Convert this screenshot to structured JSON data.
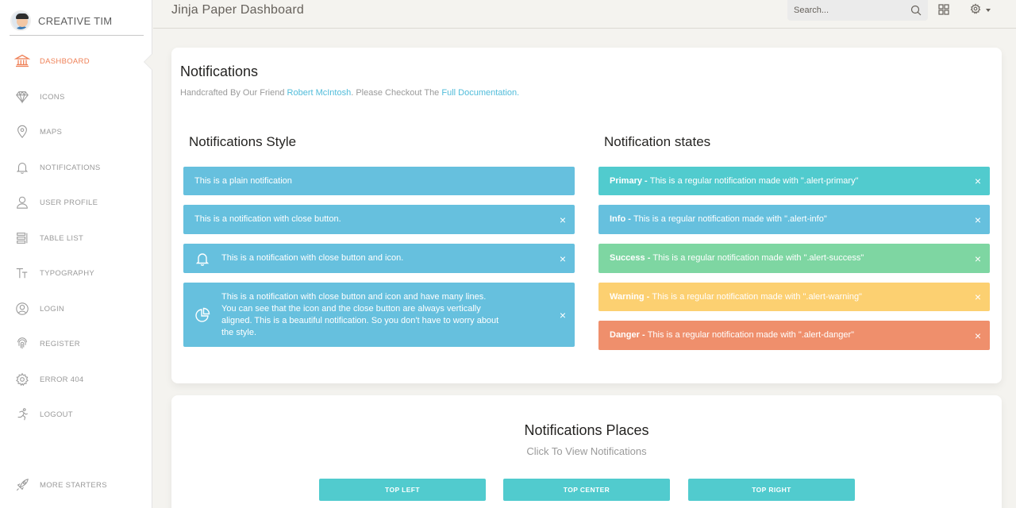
{
  "colors": {
    "primary": "#51cbce",
    "info": "#66c0de",
    "success": "#7ed6a2",
    "warning": "#fcd071",
    "danger": "#ef8f6c",
    "active_nav": "#ef8157",
    "link": "#51bcda"
  },
  "sidebar": {
    "brand": "CREATIVE TIM",
    "items": [
      {
        "label": "DASHBOARD",
        "icon": "bank-icon",
        "active": true
      },
      {
        "label": "ICONS",
        "icon": "diamond-icon"
      },
      {
        "label": "MAPS",
        "icon": "map-pin-icon"
      },
      {
        "label": "NOTIFICATIONS",
        "icon": "bell-icon"
      },
      {
        "label": "USER PROFILE",
        "icon": "user-icon"
      },
      {
        "label": "TABLE LIST",
        "icon": "table-list-icon"
      },
      {
        "label": "TYPOGRAPHY",
        "icon": "typography-icon"
      },
      {
        "label": "LOGIN",
        "icon": "user-circle-icon"
      },
      {
        "label": "REGISTER",
        "icon": "fingerprint-icon"
      },
      {
        "label": "ERROR 404",
        "icon": "gear-icon"
      },
      {
        "label": "LOGOUT",
        "icon": "running-icon"
      }
    ],
    "footer": {
      "label": "MORE STARTERS",
      "icon": "rocket-icon"
    }
  },
  "topbar": {
    "title": "Jinja Paper Dashboard",
    "search_placeholder": "Search...",
    "icons": [
      "search-icon",
      "grid-icon",
      "gear-icon"
    ]
  },
  "notifications": {
    "title": "Notifications",
    "subtitle_prefix": "Handcrafted By Our Friend ",
    "subtitle_link1": "Robert McIntosh",
    "subtitle_mid": ". Please Checkout The ",
    "subtitle_link2": "Full Documentation.",
    "style_section": {
      "title": "Notifications Style",
      "alerts": [
        {
          "text": "This is a plain notification"
        },
        {
          "text": "This is a notification with close button."
        },
        {
          "text": "This is a notification with close button and icon.",
          "icon": "bell-icon"
        },
        {
          "text": "This is a notification with close button and icon and have many lines. You can see that the icon and the close button are always vertically aligned. This is a beautiful notification. So you don't have to worry about the style.",
          "icon": "pie-chart-icon"
        }
      ]
    },
    "states_section": {
      "title": "Notification states",
      "alerts": [
        {
          "strong": "Primary - ",
          "text": "This is a regular notification made with \".alert-primary\""
        },
        {
          "strong": "Info - ",
          "text": "This is a regular notification made with \".alert-info\""
        },
        {
          "strong": "Success - ",
          "text": "This is a regular notification made with \".alert-success\""
        },
        {
          "strong": "Warning - ",
          "text": "This is a regular notification made with \".alert-warning\""
        },
        {
          "strong": "Danger - ",
          "text": "This is a regular notification made with \".alert-danger\""
        }
      ]
    },
    "close_glyph": "×"
  },
  "places": {
    "title": "Notifications Places",
    "subtitle": "Click To View Notifications",
    "buttons": [
      "TOP LEFT",
      "TOP CENTER",
      "TOP RIGHT"
    ]
  }
}
